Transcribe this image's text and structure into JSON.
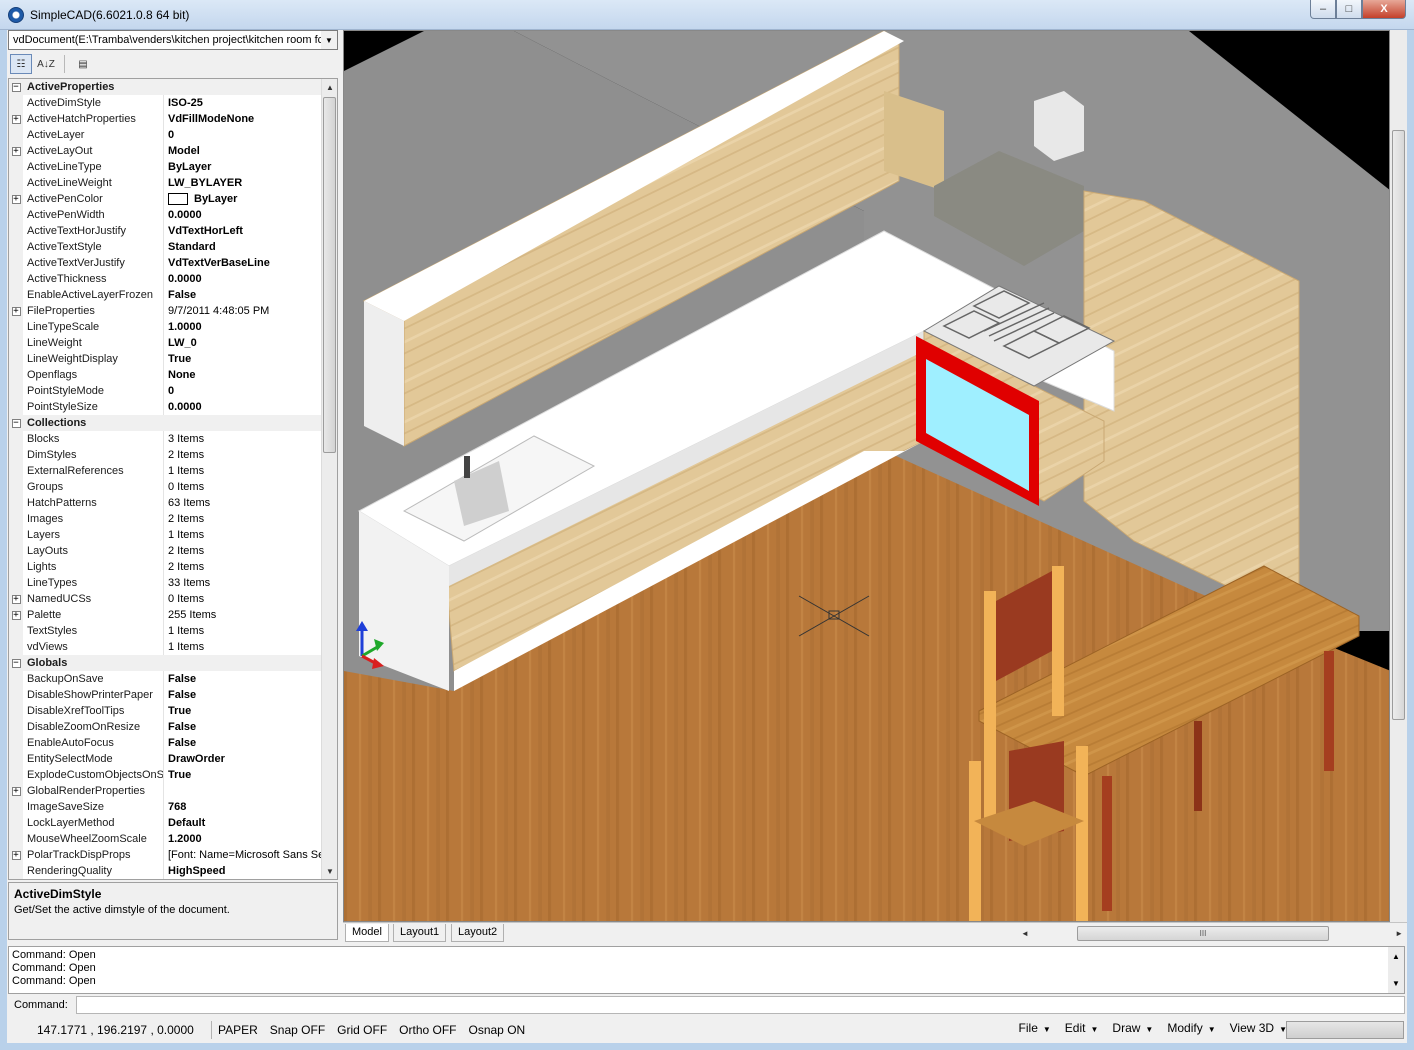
{
  "window": {
    "title": "SimpleCAD(6.6021.0.8  64 bit)",
    "minimize": "–",
    "maximize": "□",
    "close": "X"
  },
  "document_selector": {
    "value": "vdDocument(E:\\Tramba\\venders\\kitchen project\\kitchen room fc",
    "arrow": "▼"
  },
  "toolbar": {
    "categorized": "☷",
    "alphabetical": "A↓Z",
    "property_pages": "▤"
  },
  "properties": [
    {
      "type": "cat",
      "name": "ActiveProperties"
    },
    {
      "name": "ActiveDimStyle",
      "value": "ISO-25"
    },
    {
      "expand": true,
      "name": "ActiveHatchProperties",
      "value": "VdFillModeNone"
    },
    {
      "name": "ActiveLayer",
      "value": "0"
    },
    {
      "expand": true,
      "name": "ActiveLayOut",
      "value": "Model"
    },
    {
      "name": "ActiveLineType",
      "value": "ByLayer"
    },
    {
      "name": "ActiveLineWeight",
      "value": "LW_BYLAYER"
    },
    {
      "expand": true,
      "name": "ActivePenColor",
      "value": "ByLayer",
      "swatch": "#ffffff"
    },
    {
      "name": "ActivePenWidth",
      "value": "0.0000"
    },
    {
      "name": "ActiveTextHorJustify",
      "value": "VdTextHorLeft"
    },
    {
      "name": "ActiveTextStyle",
      "value": "Standard"
    },
    {
      "name": "ActiveTextVerJustify",
      "value": "VdTextVerBaseLine"
    },
    {
      "name": "ActiveThickness",
      "value": "0.0000"
    },
    {
      "name": "EnableActiveLayerFrozen",
      "value": "False"
    },
    {
      "expand": true,
      "name": "FileProperties",
      "value": "9/7/2011 4:48:05 PM",
      "plain": true
    },
    {
      "name": "LineTypeScale",
      "value": "1.0000"
    },
    {
      "name": "LineWeight",
      "value": "LW_0"
    },
    {
      "name": "LineWeightDisplay",
      "value": "True"
    },
    {
      "name": "Openflags",
      "value": "None"
    },
    {
      "name": "PointStyleMode",
      "value": "0"
    },
    {
      "name": "PointStyleSize",
      "value": "0.0000"
    },
    {
      "type": "cat",
      "name": "Collections"
    },
    {
      "name": "Blocks",
      "value": "3 Items",
      "plain": true
    },
    {
      "name": "DimStyles",
      "value": "2 Items",
      "plain": true
    },
    {
      "name": "ExternalReferences",
      "value": "1 Items",
      "plain": true
    },
    {
      "name": "Groups",
      "value": "0 Items",
      "plain": true
    },
    {
      "name": "HatchPatterns",
      "value": "63 Items",
      "plain": true
    },
    {
      "name": "Images",
      "value": "2 Items",
      "plain": true
    },
    {
      "name": "Layers",
      "value": "1 Items",
      "plain": true
    },
    {
      "name": "LayOuts",
      "value": "2 Items",
      "plain": true
    },
    {
      "name": "Lights",
      "value": "2 Items",
      "plain": true
    },
    {
      "name": "LineTypes",
      "value": "33 Items",
      "plain": true
    },
    {
      "expand": true,
      "name": "NamedUCSs",
      "value": "0 Items",
      "plain": true
    },
    {
      "expand": true,
      "name": "Palette",
      "value": "255 Items",
      "plain": true
    },
    {
      "name": "TextStyles",
      "value": "1 Items",
      "plain": true
    },
    {
      "name": "vdViews",
      "value": "1 Items",
      "plain": true
    },
    {
      "type": "cat",
      "name": "Globals"
    },
    {
      "name": "BackupOnSave",
      "value": "False"
    },
    {
      "name": "DisableShowPrinterPaper",
      "value": "False"
    },
    {
      "name": "DisableXrefToolTips",
      "value": "True"
    },
    {
      "name": "DisableZoomOnResize",
      "value": "False"
    },
    {
      "name": "EnableAutoFocus",
      "value": "False"
    },
    {
      "name": "EntitySelectMode",
      "value": "DrawOrder"
    },
    {
      "name": "ExplodeCustomObjectsOnSa",
      "value": "True"
    },
    {
      "expand": true,
      "name": "GlobalRenderProperties",
      "value": ""
    },
    {
      "name": "ImageSaveSize",
      "value": "768"
    },
    {
      "name": "LockLayerMethod",
      "value": "Default"
    },
    {
      "name": "MouseWheelZoomScale",
      "value": "1.2000"
    },
    {
      "expand": true,
      "name": "PolarTrackDispProps",
      "value": "[Font: Name=Microsoft Sans Se",
      "plain": true
    },
    {
      "name": "RenderingQuality",
      "value": "HighSpeed"
    }
  ],
  "help": {
    "title": "ActiveDimStyle",
    "description": "Get/Set the active dimstyle of the document."
  },
  "scroll_arrows": {
    "up": "▲",
    "down": "▼",
    "left": "◄",
    "right": "►",
    "grip": "III"
  },
  "layout_tabs": [
    "Model",
    "Layout1",
    "Layout2"
  ],
  "command_log": [
    "Command: Open",
    "Command: Open",
    "Command: Open"
  ],
  "command_prompt": "Command:",
  "status": {
    "coords": "147.1771 , 196.2197 , 0.0000",
    "toggles": [
      "PAPER",
      "Snap OFF",
      "Grid OFF",
      "Ortho OFF",
      "Osnap ON"
    ],
    "menus": [
      "File",
      "Edit",
      "Draw",
      "Modify",
      "View 3D"
    ],
    "menu_arrow": "▼"
  },
  "colors": {
    "wood_floor": "#b8783a",
    "cabinet": "#e2c898",
    "wall": "#8c8c8c",
    "oven_frame": "#e00000",
    "oven_glass": "#9fefff",
    "table": "#c6893e",
    "chair_back": "#9a3a20"
  }
}
